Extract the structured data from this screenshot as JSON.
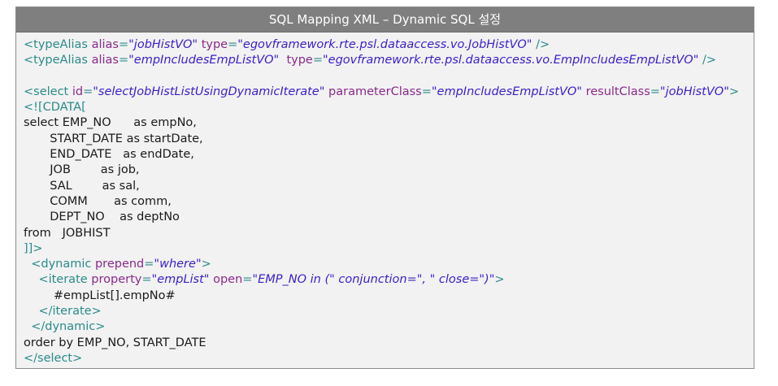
{
  "title": "SQL Mapping XML – Dynamic SQL 설정",
  "lines": [
    [
      {
        "c": "t",
        "s": "<typeAlias "
      },
      {
        "c": "a",
        "s": "alias"
      },
      {
        "c": "t",
        "s": "="
      },
      {
        "c": "v",
        "s": "\"jobHistVO\""
      },
      {
        "c": "x",
        "s": " "
      },
      {
        "c": "a",
        "s": "type"
      },
      {
        "c": "t",
        "s": "="
      },
      {
        "c": "v",
        "s": "\"egovframework.rte.psl.dataaccess.vo.JobHistVO\""
      },
      {
        "c": "t",
        "s": " />"
      }
    ],
    [
      {
        "c": "t",
        "s": "<typeAlias "
      },
      {
        "c": "a",
        "s": "alias"
      },
      {
        "c": "t",
        "s": "="
      },
      {
        "c": "v",
        "s": "\"empIncludesEmpListVO\""
      },
      {
        "c": "x",
        "s": "  "
      },
      {
        "c": "a",
        "s": "type"
      },
      {
        "c": "t",
        "s": "="
      },
      {
        "c": "v",
        "s": "\"egovframework.rte.psl.dataaccess.vo.EmpIncludesEmpListVO\""
      },
      {
        "c": "t",
        "s": " />"
      }
    ],
    [],
    [
      {
        "c": "t",
        "s": "<select "
      },
      {
        "c": "a",
        "s": "id"
      },
      {
        "c": "t",
        "s": "="
      },
      {
        "c": "v",
        "s": "\"selectJobHistListUsingDynamicIterate\""
      },
      {
        "c": "x",
        "s": " "
      },
      {
        "c": "a",
        "s": "parameterClass"
      },
      {
        "c": "t",
        "s": "="
      },
      {
        "c": "v",
        "s": "\"empIncludesEmpListVO\""
      },
      {
        "c": "x",
        "s": " "
      },
      {
        "c": "a",
        "s": "resultClass"
      },
      {
        "c": "t",
        "s": "="
      },
      {
        "c": "v",
        "s": "\"jobHistVO\""
      },
      {
        "c": "t",
        "s": ">"
      }
    ],
    [
      {
        "c": "t",
        "s": "<![CDATA["
      }
    ],
    [
      {
        "c": "x",
        "s": "select EMP_NO      as empNo,"
      }
    ],
    [
      {
        "c": "x",
        "s": "       START_DATE as startDate,"
      }
    ],
    [
      {
        "c": "x",
        "s": "       END_DATE   as endDate,"
      }
    ],
    [
      {
        "c": "x",
        "s": "       JOB        as job,"
      }
    ],
    [
      {
        "c": "x",
        "s": "       SAL        as sal,"
      }
    ],
    [
      {
        "c": "x",
        "s": "       COMM       as comm,"
      }
    ],
    [
      {
        "c": "x",
        "s": "       DEPT_NO    as deptNo"
      }
    ],
    [
      {
        "c": "x",
        "s": "from   JOBHIST"
      }
    ],
    [
      {
        "c": "t",
        "s": "]]>"
      }
    ],
    [
      {
        "c": "x",
        "s": "  "
      },
      {
        "c": "t",
        "s": "<dynamic "
      },
      {
        "c": "a",
        "s": "prepend"
      },
      {
        "c": "t",
        "s": "="
      },
      {
        "c": "v",
        "s": "\"where\""
      },
      {
        "c": "t",
        "s": ">"
      }
    ],
    [
      {
        "c": "x",
        "s": "    "
      },
      {
        "c": "t",
        "s": "<iterate "
      },
      {
        "c": "a",
        "s": "property"
      },
      {
        "c": "t",
        "s": "="
      },
      {
        "c": "v",
        "s": "\"empList\""
      },
      {
        "c": "x",
        "s": " "
      },
      {
        "c": "a",
        "s": "open"
      },
      {
        "c": "t",
        "s": "="
      },
      {
        "c": "v",
        "s": "\"EMP_NO in (\" conjunction=\", \" close=\")\""
      },
      {
        "c": "t",
        "s": ">"
      }
    ],
    [
      {
        "c": "x",
        "s": "        #empList[].empNo#"
      }
    ],
    [
      {
        "c": "x",
        "s": "    "
      },
      {
        "c": "t",
        "s": "</iterate>"
      }
    ],
    [
      {
        "c": "x",
        "s": "  "
      },
      {
        "c": "t",
        "s": "</dynamic>"
      }
    ],
    [
      {
        "c": "x",
        "s": "order by EMP_NO, START_DATE"
      }
    ],
    [
      {
        "c": "t",
        "s": "</select>"
      }
    ]
  ]
}
